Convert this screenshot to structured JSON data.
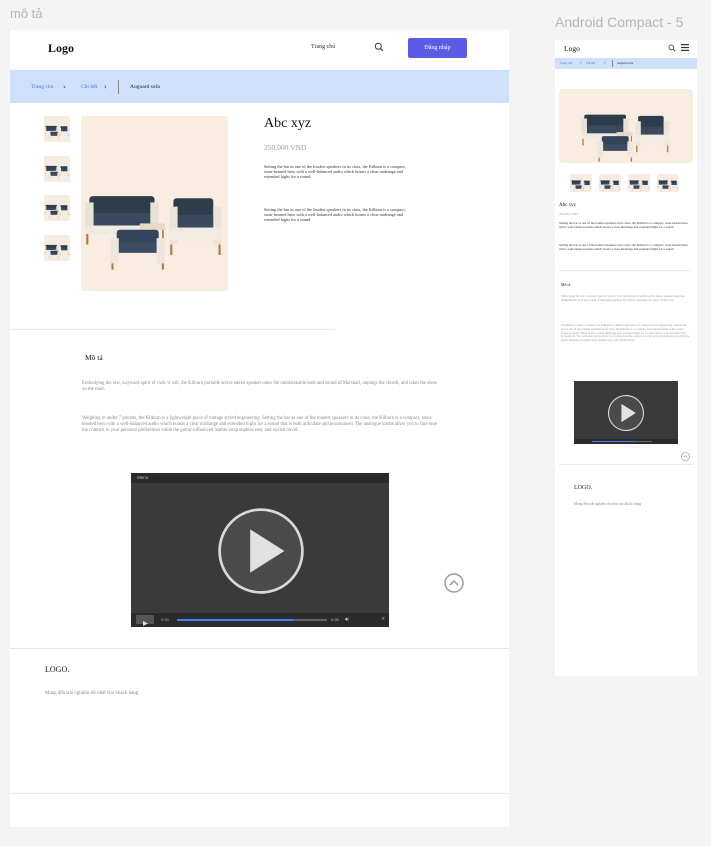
{
  "frames": {
    "desktop_label": "mô tả",
    "mobile_label": "Android Compact - 5"
  },
  "header": {
    "logo": "Logo",
    "nav_home": "Trang chủ",
    "cta_label": "Đăng nhập"
  },
  "breadcrumb": {
    "home": "Trang chủ",
    "detail": "Chi tiết",
    "current": "Auguard sofa"
  },
  "product": {
    "title": "Abc xyz",
    "price": "250,000 VND",
    "desc1": "Setting the bar as one of the loudest speakers in its class, the Kilburn is a compact, stout-hearted hero with a well-balanced audio which boasts a clear midrange and extended highs for a sound.",
    "desc2": "Setting the bar as one of the loudest speakers in its class, the Kilburn is a compact, stout-hearted hero with a well-balanced audio which boasts a clear midrange and extended highs for a sound."
  },
  "description": {
    "heading": "Mô tả",
    "para1": "Embodying the raw, wayward spirit of rock 'n' roll, the Kilburn portable active stereo speaker takes the unmistakable look and sound of Marshall, unplugs the chords, and takes the show on the road.",
    "para2": "Weighing in under 7 pounds, the Kilburn is a lightweight piece of vintage styled engineering. Setting the bar as one of the loudest speakers in its class, the Kilburn is a compact, stout-hearted hero with a well-balanced audio which boasts a clear midrange and extended highs for a sound that is both articulate and pronounced. The analogue knobs allow you to fine tune the controls to your personal preferences while the guitar-influenced leather strap enables easy and stylish travel."
  },
  "video": {
    "menu_label": "Menu",
    "time_current": "0:00",
    "time_total": "0:26",
    "progress": 0.77,
    "mobile_progress": 0.72
  },
  "footer": {
    "logo": "LOGO.",
    "tagline": "Mang đến trải nghiệm tốt nhất cho khách hàng"
  },
  "colors": {
    "accent": "#5b5be6",
    "breadcrumb_bg": "#cfe0fa",
    "link": "#4b6fd8",
    "product_bg": "#f9ece1"
  }
}
